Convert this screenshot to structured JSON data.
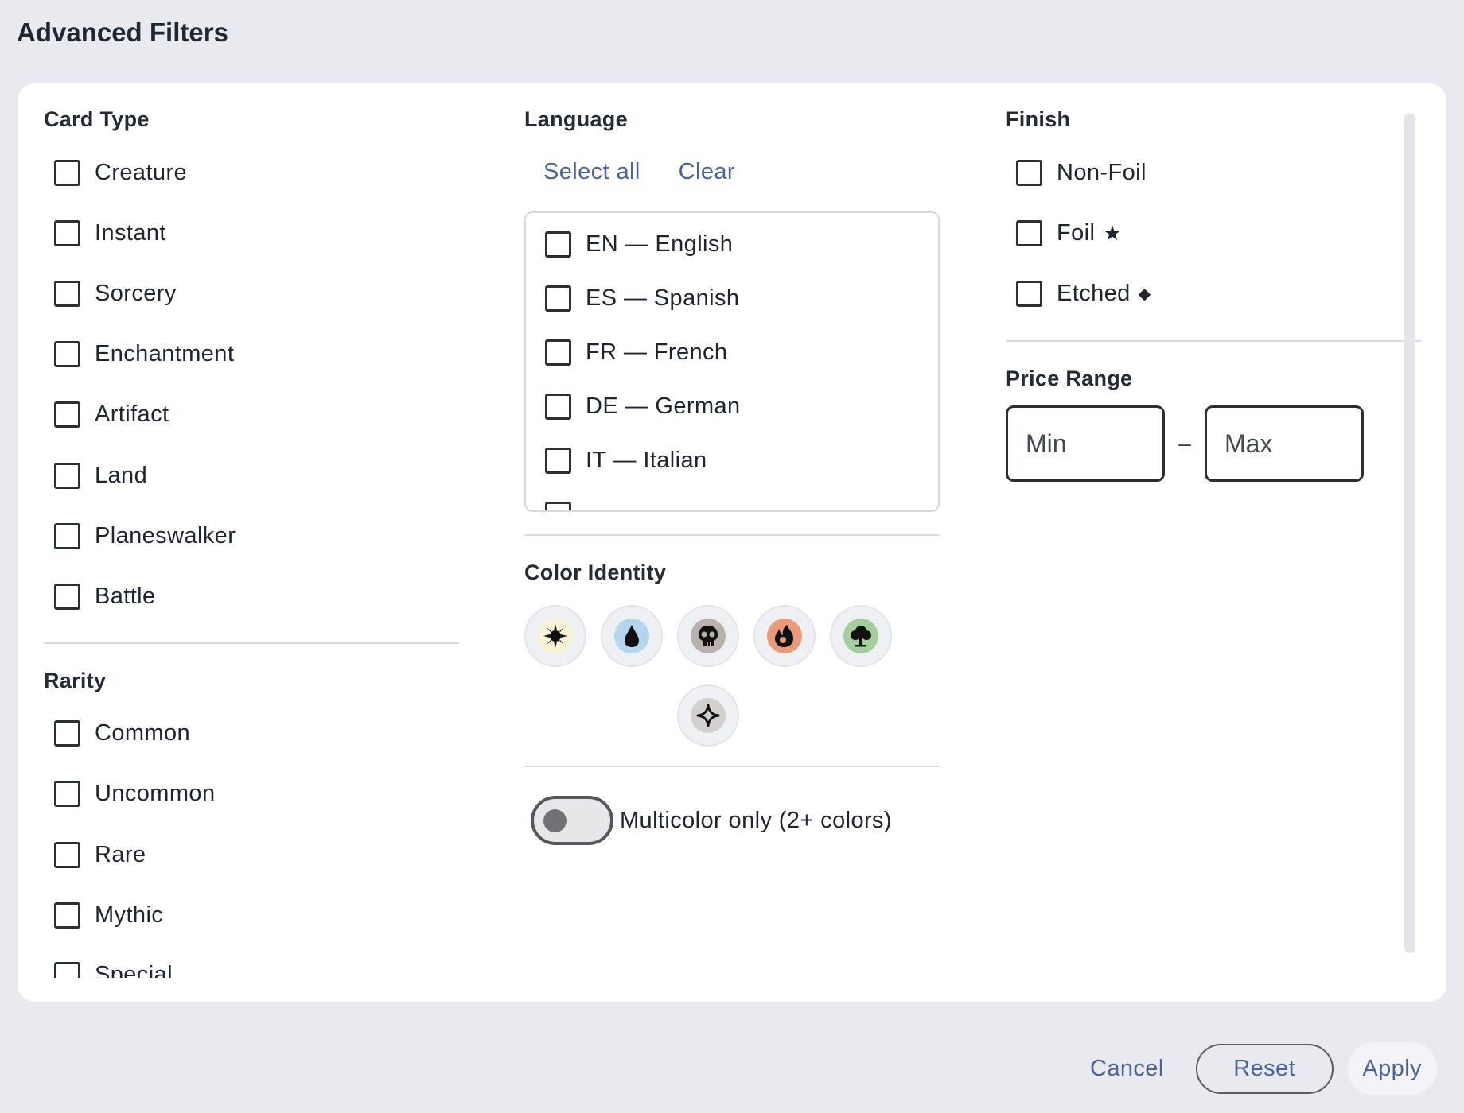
{
  "dialog": {
    "title": "Advanced Filters"
  },
  "card_type": {
    "title": "Card Type",
    "items": [
      "Creature",
      "Instant",
      "Sorcery",
      "Enchantment",
      "Artifact",
      "Land",
      "Planeswalker",
      "Battle"
    ]
  },
  "rarity": {
    "title": "Rarity",
    "items": [
      "Common",
      "Uncommon",
      "Rare",
      "Mythic",
      "Special"
    ]
  },
  "language": {
    "title": "Language",
    "select_all": "Select all",
    "clear": "Clear",
    "items": [
      "EN — English",
      "ES — Spanish",
      "FR — French",
      "DE — German",
      "IT — Italian"
    ]
  },
  "color_identity": {
    "title": "Color Identity",
    "icons": [
      "white-mana-sun-icon",
      "blue-mana-drop-icon",
      "black-mana-skull-icon",
      "red-mana-fire-icon",
      "green-mana-tree-icon",
      "colorless-mana-diamond-icon"
    ],
    "colors": {
      "white": "#f8f3d6",
      "blue": "#b3d6ee",
      "black": "#b9b1ad",
      "red": "#e99a7b",
      "green": "#a4cf9d",
      "colorless": "#d3cfcc"
    }
  },
  "multicolor": {
    "label": "Multicolor only (2+ colors)",
    "enabled": false
  },
  "finish": {
    "title": "Finish",
    "items": [
      {
        "label": "Non-Foil",
        "suffix": ""
      },
      {
        "label": "Foil",
        "suffix": "★"
      },
      {
        "label": "Etched",
        "suffix": "◆"
      }
    ]
  },
  "price_range": {
    "title": "Price Range",
    "min_placeholder": "Min",
    "max_placeholder": "Max",
    "separator": "–"
  },
  "footer": {
    "cancel": "Cancel",
    "reset": "Reset",
    "apply": "Apply"
  },
  "theme": {
    "link": "#4b6498",
    "background": "#e9e9f0",
    "panel": "#ffffff"
  }
}
